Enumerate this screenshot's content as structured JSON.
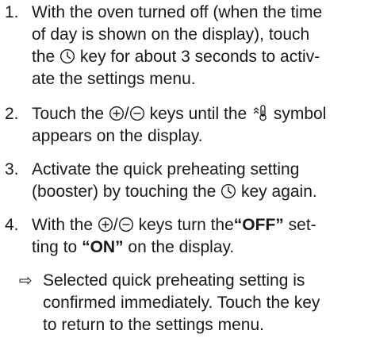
{
  "steps": [
    {
      "number": "1.",
      "line1": "With the oven turned off (when the time",
      "line2": "of day is shown on the display), touch",
      "line3a": "the",
      "icon": "clock-icon",
      "line3b": "key for about 3 seconds to activ-",
      "line4": "ate the settings menu."
    },
    {
      "number": "2.",
      "line1a": "Touch the",
      "sep": "/",
      "line1b": "keys until the",
      "line1c": "symbol",
      "line2": "appears on the display.",
      "icons": [
        "plus-circle-icon",
        "minus-circle-icon",
        "quick-preheat-icon"
      ]
    },
    {
      "number": "3.",
      "line1": "Activate the quick preheating setting",
      "line2a": "(booster) by touching the",
      "icon": "clock-icon",
      "line2b": "key again."
    },
    {
      "number": "4.",
      "line1a": "With the",
      "sep": "/",
      "line1b": "keys turn the",
      "off": "“OFF”",
      "line1c": "set-",
      "line2a": "ting to",
      "on": "“ON”",
      "line2b": "on the display.",
      "icons": [
        "plus-circle-icon",
        "minus-circle-icon"
      ]
    }
  ],
  "result": {
    "arrow": "⇨",
    "line1": "Selected quick preheating setting is",
    "line2": "confirmed immediately. Touch the key",
    "line3": "to return to the settings menu."
  }
}
